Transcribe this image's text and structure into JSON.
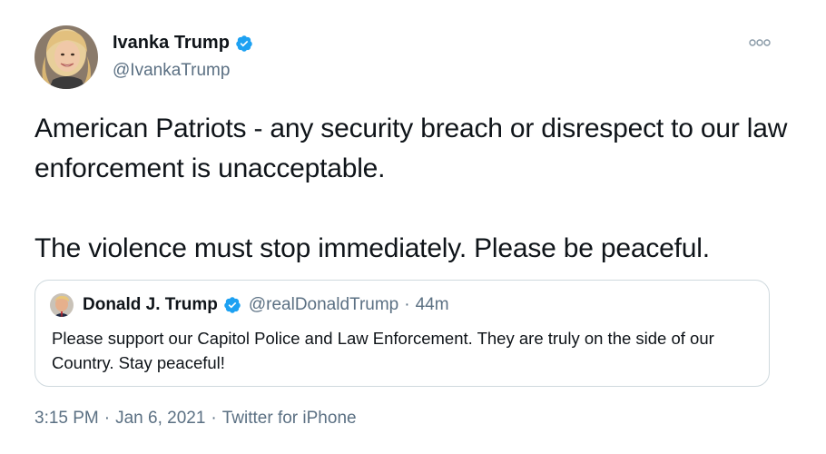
{
  "tweet": {
    "author": {
      "name": "Ivanka Trump",
      "handle": "@IvankaTrump",
      "verified_icon": "verified-badge-icon"
    },
    "more_icon": "more-options-icon",
    "paragraphs": [
      "American Patriots - any security breach or disrespect to our law enforcement is unacceptable.",
      "The violence must stop immediately. Please be peaceful."
    ],
    "quoted": {
      "name": "Donald J. Trump",
      "handle": "@realDonaldTrump",
      "separator": "·",
      "time": "44m",
      "text": "Please support our Capitol Police and Law Enforcement. They are truly on the side of our Country. Stay peaceful!"
    },
    "meta": {
      "time": "3:15 PM",
      "separator": "·",
      "date": "Jan 6, 2021",
      "source": "Twitter for iPhone"
    }
  },
  "colors": {
    "text": "#0f1419",
    "secondary_text": "#5b7083",
    "verified": "#1da1f2",
    "border": "#cfd9de"
  }
}
